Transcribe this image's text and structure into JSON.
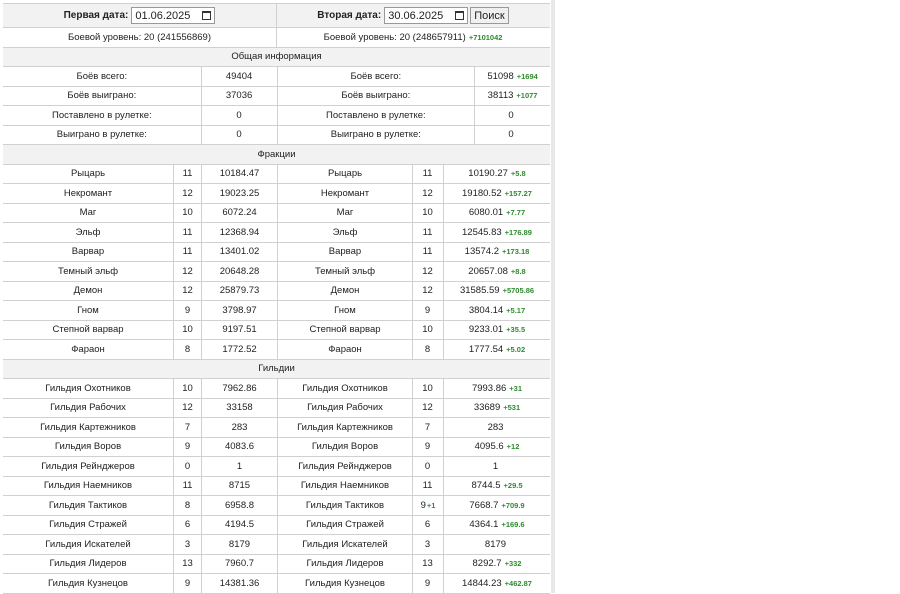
{
  "header": {
    "first_date_label": "Первая дата:",
    "first_date_value": "01.06.2025",
    "second_date_label": "Вторая дата:",
    "second_date_value": "30.06.2025",
    "search_label": "Поиск"
  },
  "combat_level": {
    "left": "Боевой уровень: 20 (241556869)",
    "right": "Боевой уровень: 20 (248657911)",
    "right_delta": "+7101042"
  },
  "sections": {
    "general": "Общая информация",
    "factions": "Фракции",
    "guilds": "Гильдии"
  },
  "general_rows": [
    {
      "label": "Боёв всего:",
      "left": "49404",
      "right": "51098",
      "delta": "+1694"
    },
    {
      "label": "Боёв выиграно:",
      "left": "37036",
      "right": "38113",
      "delta": "+1077"
    },
    {
      "label": "Поставлено в рулетке:",
      "left": "0",
      "right": "0",
      "delta": ""
    },
    {
      "label": "Выиграно в рулетке:",
      "left": "0",
      "right": "0",
      "delta": ""
    }
  ],
  "faction_rows": [
    {
      "name": "Рыцарь",
      "lvl1": "11",
      "val1": "10184.47",
      "lvl2": "11",
      "lvl_delta": "",
      "val2": "10190.27",
      "delta": "+5.8"
    },
    {
      "name": "Некромант",
      "lvl1": "12",
      "val1": "19023.25",
      "lvl2": "12",
      "lvl_delta": "",
      "val2": "19180.52",
      "delta": "+157.27"
    },
    {
      "name": "Маг",
      "lvl1": "10",
      "val1": "6072.24",
      "lvl2": "10",
      "lvl_delta": "",
      "val2": "6080.01",
      "delta": "+7.77"
    },
    {
      "name": "Эльф",
      "lvl1": "11",
      "val1": "12368.94",
      "lvl2": "11",
      "lvl_delta": "",
      "val2": "12545.83",
      "delta": "+176.89"
    },
    {
      "name": "Варвар",
      "lvl1": "11",
      "val1": "13401.02",
      "lvl2": "11",
      "lvl_delta": "",
      "val2": "13574.2",
      "delta": "+173.18"
    },
    {
      "name": "Темный эльф",
      "lvl1": "12",
      "val1": "20648.28",
      "lvl2": "12",
      "lvl_delta": "",
      "val2": "20657.08",
      "delta": "+8.8"
    },
    {
      "name": "Демон",
      "lvl1": "12",
      "val1": "25879.73",
      "lvl2": "12",
      "lvl_delta": "",
      "val2": "31585.59",
      "delta": "+5705.86"
    },
    {
      "name": "Гном",
      "lvl1": "9",
      "val1": "3798.97",
      "lvl2": "9",
      "lvl_delta": "",
      "val2": "3804.14",
      "delta": "+5.17"
    },
    {
      "name": "Степной варвар",
      "lvl1": "10",
      "val1": "9197.51",
      "lvl2": "10",
      "lvl_delta": "",
      "val2": "9233.01",
      "delta": "+35.5"
    },
    {
      "name": "Фараон",
      "lvl1": "8",
      "val1": "1772.52",
      "lvl2": "8",
      "lvl_delta": "",
      "val2": "1777.54",
      "delta": "+5.02"
    }
  ],
  "guild_rows": [
    {
      "name": "Гильдия Охотников",
      "lvl1": "10",
      "val1": "7962.86",
      "lvl2": "10",
      "lvl_delta": "",
      "val2": "7993.86",
      "delta": "+31"
    },
    {
      "name": "Гильдия Рабочих",
      "lvl1": "12",
      "val1": "33158",
      "lvl2": "12",
      "lvl_delta": "",
      "val2": "33689",
      "delta": "+531"
    },
    {
      "name": "Гильдия Картежников",
      "lvl1": "7",
      "val1": "283",
      "lvl2": "7",
      "lvl_delta": "",
      "val2": "283",
      "delta": ""
    },
    {
      "name": "Гильдия Воров",
      "lvl1": "9",
      "val1": "4083.6",
      "lvl2": "9",
      "lvl_delta": "",
      "val2": "4095.6",
      "delta": "+12"
    },
    {
      "name": "Гильдия Рейнджеров",
      "lvl1": "0",
      "val1": "1",
      "lvl2": "0",
      "lvl_delta": "",
      "val2": "1",
      "delta": ""
    },
    {
      "name": "Гильдия Наемников",
      "lvl1": "11",
      "val1": "8715",
      "lvl2": "11",
      "lvl_delta": "",
      "val2": "8744.5",
      "delta": "+29.5"
    },
    {
      "name": "Гильдия Тактиков",
      "lvl1": "8",
      "val1": "6958.8",
      "lvl2": "9",
      "lvl_delta": "+1",
      "val2": "7668.7",
      "delta": "+709.9"
    },
    {
      "name": "Гильдия Стражей",
      "lvl1": "6",
      "val1": "4194.5",
      "lvl2": "6",
      "lvl_delta": "",
      "val2": "4364.1",
      "delta": "+169.6"
    },
    {
      "name": "Гильдия Искателей",
      "lvl1": "3",
      "val1": "8179",
      "lvl2": "3",
      "lvl_delta": "",
      "val2": "8179",
      "delta": ""
    },
    {
      "name": "Гильдия Лидеров",
      "lvl1": "13",
      "val1": "7960.7",
      "lvl2": "13",
      "lvl_delta": "",
      "val2": "8292.7",
      "delta": "+332"
    },
    {
      "name": "Гильдия Кузнецов",
      "lvl1": "9",
      "val1": "14381.36",
      "lvl2": "9",
      "lvl_delta": "",
      "val2": "14844.23",
      "delta": "+462.87"
    }
  ],
  "colors": {
    "delta": "#2e8b2e",
    "header_bg": "#f2f2f2",
    "border": "#d0d0d0"
  }
}
